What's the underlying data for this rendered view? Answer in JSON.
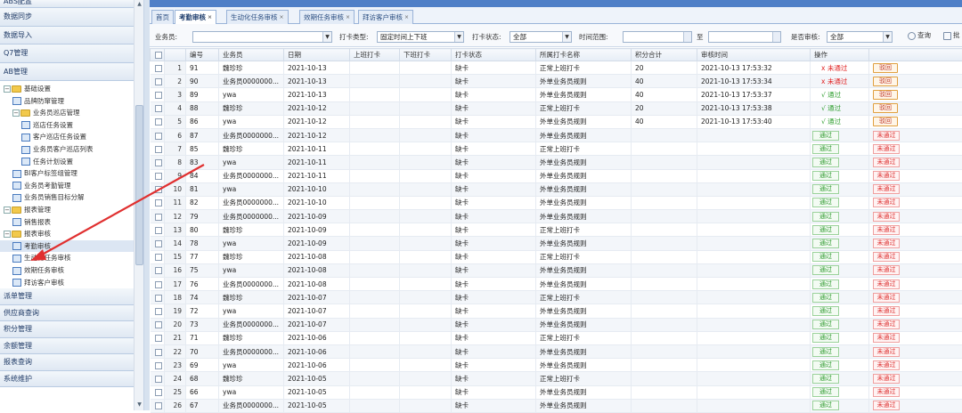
{
  "sidebar": {
    "top_items": [
      "ABS配置",
      "数据同步",
      "数据导入",
      "Q7管理",
      "AB管理"
    ],
    "tree": [
      {
        "level": 0,
        "label": "基础设置",
        "type": "folder",
        "toggle": "−"
      },
      {
        "level": 1,
        "label": "品牌防窜管理",
        "type": "doc"
      },
      {
        "level": 1,
        "label": "业务员巡店管理",
        "type": "folder",
        "toggle": "−"
      },
      {
        "level": 2,
        "label": "巡店任务设置",
        "type": "doc"
      },
      {
        "level": 2,
        "label": "客户巡店任务设置",
        "type": "doc"
      },
      {
        "level": 2,
        "label": "业务员客户巡店列表",
        "type": "doc"
      },
      {
        "level": 2,
        "label": "任务计划设置",
        "type": "doc"
      },
      {
        "level": 1,
        "label": "BI客户标签组管理",
        "type": "doc"
      },
      {
        "level": 1,
        "label": "业务员考勤管理",
        "type": "doc"
      },
      {
        "level": 1,
        "label": "业务员销售目标分解",
        "type": "doc"
      },
      {
        "level": 0,
        "label": "报表管理",
        "type": "folder",
        "toggle": "−"
      },
      {
        "level": 1,
        "label": "销售报表",
        "type": "doc"
      },
      {
        "level": 0,
        "label": "报表审核",
        "type": "folder",
        "toggle": "−"
      },
      {
        "level": 1,
        "label": "考勤审核",
        "type": "doc",
        "selected": true
      },
      {
        "level": 1,
        "label": "生动化任务审核",
        "type": "doc"
      },
      {
        "level": 1,
        "label": "效期任务审核",
        "type": "doc"
      },
      {
        "level": 1,
        "label": "拜访客户审核",
        "type": "doc"
      }
    ],
    "bottom_items": [
      "派单管理",
      "供应商查询",
      "积分管理",
      "余额管理",
      "报表查询",
      "系统维护"
    ]
  },
  "tabs": [
    {
      "label": "首页",
      "closable": false,
      "active": false
    },
    {
      "label": "考勤审核",
      "closable": true,
      "active": true
    },
    {
      "label": "生动化任务审核",
      "closable": true,
      "active": false
    },
    {
      "label": "效期任务审核",
      "closable": true,
      "active": false
    },
    {
      "label": "拜访客户审核",
      "closable": true,
      "active": false
    }
  ],
  "filter": {
    "salesman_label": "业务员:",
    "salesman_value": "",
    "punch_type_label": "打卡类型:",
    "punch_type_value": "固定时间上下班",
    "punch_status_label": "打卡状态:",
    "punch_status_value": "全部",
    "time_range_label": "时间范围:",
    "time_from": "",
    "to_label": "至",
    "time_to": "",
    "approved_label": "是否审核:",
    "approved_value": "全部",
    "query_label": "查询",
    "extra_label": "批"
  },
  "columns": [
    "",
    "",
    "编号",
    "业务员",
    "日期",
    "上班打卡",
    "下班打卡",
    "打卡状态",
    "所属打卡名称",
    "积分合计",
    "审核时间",
    "操作",
    ""
  ],
  "rows": [
    {
      "n": "1",
      "id": "91",
      "who": "魏珍珍",
      "date": "2021-10-13",
      "status": "缺卡",
      "rule": "正常上班打卡",
      "pts": "20",
      "time": "2021-10-13 17:53:32",
      "state": "rejected"
    },
    {
      "n": "2",
      "id": "90",
      "who": "业务员0000000...",
      "date": "2021-10-13",
      "status": "缺卡",
      "rule": "外单业务员规则",
      "pts": "40",
      "time": "2021-10-13 17:53:34",
      "state": "rejected"
    },
    {
      "n": "3",
      "id": "89",
      "who": "ywa",
      "date": "2021-10-13",
      "status": "缺卡",
      "rule": "外单业务员规则",
      "pts": "40",
      "time": "2021-10-13 17:53:37",
      "state": "passed"
    },
    {
      "n": "4",
      "id": "88",
      "who": "魏珍珍",
      "date": "2021-10-12",
      "status": "缺卡",
      "rule": "正常上班打卡",
      "pts": "20",
      "time": "2021-10-13 17:53:38",
      "state": "passed"
    },
    {
      "n": "5",
      "id": "86",
      "who": "ywa",
      "date": "2021-10-12",
      "status": "缺卡",
      "rule": "外单业务员规则",
      "pts": "40",
      "time": "2021-10-13 17:53:40",
      "state": "passed"
    },
    {
      "n": "6",
      "id": "87",
      "who": "业务员0000000...",
      "date": "2021-10-12",
      "status": "缺卡",
      "rule": "外单业务员规则",
      "pts": "",
      "time": "",
      "state": "pending"
    },
    {
      "n": "7",
      "id": "85",
      "who": "魏珍珍",
      "date": "2021-10-11",
      "status": "缺卡",
      "rule": "正常上班打卡",
      "pts": "",
      "time": "",
      "state": "pending"
    },
    {
      "n": "8",
      "id": "83",
      "who": "ywa",
      "date": "2021-10-11",
      "status": "缺卡",
      "rule": "外单业务员规则",
      "pts": "",
      "time": "",
      "state": "pending"
    },
    {
      "n": "9",
      "id": "84",
      "who": "业务员0000000...",
      "date": "2021-10-11",
      "status": "缺卡",
      "rule": "外单业务员规则",
      "pts": "",
      "time": "",
      "state": "pending"
    },
    {
      "n": "10",
      "id": "81",
      "who": "ywa",
      "date": "2021-10-10",
      "status": "缺卡",
      "rule": "外单业务员规则",
      "pts": "",
      "time": "",
      "state": "pending"
    },
    {
      "n": "11",
      "id": "82",
      "who": "业务员0000000...",
      "date": "2021-10-10",
      "status": "缺卡",
      "rule": "外单业务员规则",
      "pts": "",
      "time": "",
      "state": "pending"
    },
    {
      "n": "12",
      "id": "79",
      "who": "业务员0000000...",
      "date": "2021-10-09",
      "status": "缺卡",
      "rule": "外单业务员规则",
      "pts": "",
      "time": "",
      "state": "pending"
    },
    {
      "n": "13",
      "id": "80",
      "who": "魏珍珍",
      "date": "2021-10-09",
      "status": "缺卡",
      "rule": "正常上班打卡",
      "pts": "",
      "time": "",
      "state": "pending"
    },
    {
      "n": "14",
      "id": "78",
      "who": "ywa",
      "date": "2021-10-09",
      "status": "缺卡",
      "rule": "外单业务员规则",
      "pts": "",
      "time": "",
      "state": "pending"
    },
    {
      "n": "15",
      "id": "77",
      "who": "魏珍珍",
      "date": "2021-10-08",
      "status": "缺卡",
      "rule": "正常上班打卡",
      "pts": "",
      "time": "",
      "state": "pending"
    },
    {
      "n": "16",
      "id": "75",
      "who": "ywa",
      "date": "2021-10-08",
      "status": "缺卡",
      "rule": "外单业务员规则",
      "pts": "",
      "time": "",
      "state": "pending"
    },
    {
      "n": "17",
      "id": "76",
      "who": "业务员0000000...",
      "date": "2021-10-08",
      "status": "缺卡",
      "rule": "外单业务员规则",
      "pts": "",
      "time": "",
      "state": "pending"
    },
    {
      "n": "18",
      "id": "74",
      "who": "魏珍珍",
      "date": "2021-10-07",
      "status": "缺卡",
      "rule": "正常上班打卡",
      "pts": "",
      "time": "",
      "state": "pending"
    },
    {
      "n": "19",
      "id": "72",
      "who": "ywa",
      "date": "2021-10-07",
      "status": "缺卡",
      "rule": "外单业务员规则",
      "pts": "",
      "time": "",
      "state": "pending"
    },
    {
      "n": "20",
      "id": "73",
      "who": "业务员0000000...",
      "date": "2021-10-07",
      "status": "缺卡",
      "rule": "外单业务员规则",
      "pts": "",
      "time": "",
      "state": "pending"
    },
    {
      "n": "21",
      "id": "71",
      "who": "魏珍珍",
      "date": "2021-10-06",
      "status": "缺卡",
      "rule": "正常上班打卡",
      "pts": "",
      "time": "",
      "state": "pending"
    },
    {
      "n": "22",
      "id": "70",
      "who": "业务员0000000...",
      "date": "2021-10-06",
      "status": "缺卡",
      "rule": "外单业务员规则",
      "pts": "",
      "time": "",
      "state": "pending"
    },
    {
      "n": "23",
      "id": "69",
      "who": "ywa",
      "date": "2021-10-06",
      "status": "缺卡",
      "rule": "外单业务员规则",
      "pts": "",
      "time": "",
      "state": "pending"
    },
    {
      "n": "24",
      "id": "68",
      "who": "魏珍珍",
      "date": "2021-10-05",
      "status": "缺卡",
      "rule": "正常上班打卡",
      "pts": "",
      "time": "",
      "state": "pending"
    },
    {
      "n": "25",
      "id": "66",
      "who": "ywa",
      "date": "2021-10-05",
      "status": "缺卡",
      "rule": "外单业务员规则",
      "pts": "",
      "time": "",
      "state": "pending"
    },
    {
      "n": "26",
      "id": "67",
      "who": "业务员0000000...",
      "date": "2021-10-05",
      "status": "缺卡",
      "rule": "外单业务员规则",
      "pts": "",
      "time": "",
      "state": "pending"
    }
  ],
  "labels": {
    "rejected": "x 未通过",
    "passed": "√ 通过",
    "reject_btn": "驳回",
    "pass_btn": "通过",
    "fail_btn": "未通过"
  },
  "colors": {
    "accent": "#4f7fc7",
    "annotation_arrow": "#e03030"
  }
}
